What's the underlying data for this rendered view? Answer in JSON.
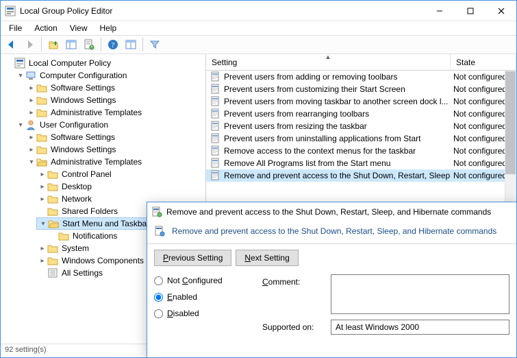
{
  "window": {
    "title": "Local Group Policy Editor"
  },
  "menu": {
    "file": "File",
    "action": "Action",
    "view": "View",
    "help": "Help"
  },
  "tree": {
    "root": "Local Computer Policy",
    "cc": "Computer Configuration",
    "cc_ss": "Software Settings",
    "cc_ws": "Windows Settings",
    "cc_at": "Administrative Templates",
    "uc": "User Configuration",
    "uc_ss": "Software Settings",
    "uc_ws": "Windows Settings",
    "uc_at": "Administrative Templates",
    "uc_at_cp": "Control Panel",
    "uc_at_dt": "Desktop",
    "uc_at_nw": "Network",
    "uc_at_sf": "Shared Folders",
    "uc_at_smt": "Start Menu and Taskbar",
    "uc_at_smt_not": "Notifications",
    "uc_at_sys": "System",
    "uc_at_wc": "Windows Components",
    "uc_at_all": "All Settings"
  },
  "list": {
    "header_setting": "Setting",
    "header_state": "State",
    "rows": [
      {
        "name": "Prevent users from adding or removing toolbars",
        "state": "Not configured"
      },
      {
        "name": "Prevent users from customizing their Start Screen",
        "state": "Not configured"
      },
      {
        "name": "Prevent users from moving taskbar to another screen dock l...",
        "state": "Not configured"
      },
      {
        "name": "Prevent users from rearranging toolbars",
        "state": "Not configured"
      },
      {
        "name": "Prevent users from resizing the taskbar",
        "state": "Not configured"
      },
      {
        "name": "Prevent users from uninstalling applications from Start",
        "state": "Not configured"
      },
      {
        "name": "Remove access to the context menus for the taskbar",
        "state": "Not configured"
      },
      {
        "name": "Remove All Programs list from the Start menu",
        "state": "Not configured"
      },
      {
        "name": "Remove and prevent access to the Shut Down, Restart, Sleep...",
        "state": "Not configured"
      }
    ]
  },
  "statusbar": "92 setting(s)",
  "dialog": {
    "title": "Remove and prevent access to the Shut Down, Restart, Sleep, and Hibernate commands",
    "banner": "Remove and prevent access to the Shut Down, Restart, Sleep, and Hibernate commands",
    "prev_p": "P",
    "prev_rest": "revious Setting",
    "next_n": "N",
    "next_rest": "ext Setting",
    "opt_notconf_c": "C",
    "opt_notconf_rest": "onfigured",
    "opt_notconf_pre": "Not ",
    "opt_enabled_e": "E",
    "opt_enabled_rest": "nabled",
    "opt_disabled_d": "D",
    "opt_disabled_rest": "isabled",
    "comment_label_c": "C",
    "comment_label_rest": "omment:",
    "supported_label": "Supported on:",
    "supported_value": "At least Windows 2000"
  }
}
